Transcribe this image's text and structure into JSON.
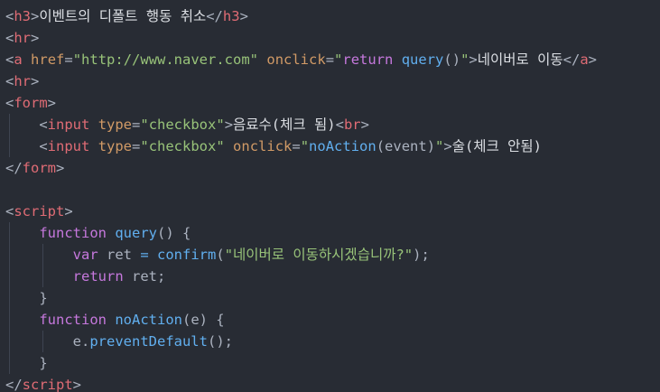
{
  "lines": [
    [
      {
        "t": "<",
        "c": "pun"
      },
      {
        "t": "h3",
        "c": "tag"
      },
      {
        "t": ">",
        "c": "pun"
      },
      {
        "t": "이벤트의 디폴트 행동 취소",
        "c": "txt"
      },
      {
        "t": "</",
        "c": "pun"
      },
      {
        "t": "h3",
        "c": "tag"
      },
      {
        "t": ">",
        "c": "pun"
      }
    ],
    [
      {
        "t": "<",
        "c": "pun"
      },
      {
        "t": "hr",
        "c": "tag"
      },
      {
        "t": ">",
        "c": "pun"
      }
    ],
    [
      {
        "t": "<",
        "c": "pun"
      },
      {
        "t": "a",
        "c": "tag"
      },
      {
        "t": " ",
        "c": "pun"
      },
      {
        "t": "href",
        "c": "attr"
      },
      {
        "t": "=",
        "c": "pun"
      },
      {
        "t": "\"http://www.naver.com\"",
        "c": "str"
      },
      {
        "t": " ",
        "c": "pun"
      },
      {
        "t": "onclick",
        "c": "attr"
      },
      {
        "t": "=",
        "c": "pun"
      },
      {
        "t": "\"",
        "c": "str"
      },
      {
        "t": "return",
        "c": "kw"
      },
      {
        "t": " ",
        "c": "pun"
      },
      {
        "t": "query",
        "c": "fn"
      },
      {
        "t": "()",
        "c": "pun"
      },
      {
        "t": "\"",
        "c": "str"
      },
      {
        "t": ">",
        "c": "pun"
      },
      {
        "t": "네이버로 이동",
        "c": "txt"
      },
      {
        "t": "</",
        "c": "pun"
      },
      {
        "t": "a",
        "c": "tag"
      },
      {
        "t": ">",
        "c": "pun"
      }
    ],
    [
      {
        "t": "<",
        "c": "pun"
      },
      {
        "t": "hr",
        "c": "tag"
      },
      {
        "t": ">",
        "c": "pun"
      }
    ],
    [
      {
        "t": "<",
        "c": "pun"
      },
      {
        "t": "form",
        "c": "tag"
      },
      {
        "t": ">",
        "c": "pun"
      }
    ],
    [
      {
        "t": "    <",
        "c": "pun"
      },
      {
        "t": "input",
        "c": "tag"
      },
      {
        "t": " ",
        "c": "pun"
      },
      {
        "t": "type",
        "c": "attr"
      },
      {
        "t": "=",
        "c": "pun"
      },
      {
        "t": "\"checkbox\"",
        "c": "str"
      },
      {
        "t": ">",
        "c": "pun"
      },
      {
        "t": "음료수(체크 됨)",
        "c": "txt"
      },
      {
        "t": "<",
        "c": "pun"
      },
      {
        "t": "br",
        "c": "tag"
      },
      {
        "t": ">",
        "c": "pun"
      }
    ],
    [
      {
        "t": "    <",
        "c": "pun"
      },
      {
        "t": "input",
        "c": "tag"
      },
      {
        "t": " ",
        "c": "pun"
      },
      {
        "t": "type",
        "c": "attr"
      },
      {
        "t": "=",
        "c": "pun"
      },
      {
        "t": "\"checkbox\"",
        "c": "str"
      },
      {
        "t": " ",
        "c": "pun"
      },
      {
        "t": "onclick",
        "c": "attr"
      },
      {
        "t": "=",
        "c": "pun"
      },
      {
        "t": "\"",
        "c": "str"
      },
      {
        "t": "noAction",
        "c": "fn"
      },
      {
        "t": "(event)",
        "c": "pun"
      },
      {
        "t": "\"",
        "c": "str"
      },
      {
        "t": ">",
        "c": "pun"
      },
      {
        "t": "술(체크 안됨)",
        "c": "txt"
      }
    ],
    [
      {
        "t": "</",
        "c": "pun"
      },
      {
        "t": "form",
        "c": "tag"
      },
      {
        "t": ">",
        "c": "pun"
      }
    ],
    [],
    [
      {
        "t": "<",
        "c": "pun"
      },
      {
        "t": "script",
        "c": "tag"
      },
      {
        "t": ">",
        "c": "pun"
      }
    ],
    [
      {
        "t": "    ",
        "c": "pun"
      },
      {
        "t": "function",
        "c": "kw"
      },
      {
        "t": " ",
        "c": "pun"
      },
      {
        "t": "query",
        "c": "fn"
      },
      {
        "t": "() {",
        "c": "pun"
      }
    ],
    [
      {
        "t": "        ",
        "c": "pun"
      },
      {
        "t": "var",
        "c": "kw"
      },
      {
        "t": " ret ",
        "c": "pun"
      },
      {
        "t": "=",
        "c": "fn"
      },
      {
        "t": " ",
        "c": "pun"
      },
      {
        "t": "confirm",
        "c": "fn"
      },
      {
        "t": "(",
        "c": "pun"
      },
      {
        "t": "\"네이버로 이동하시겠습니까?\"",
        "c": "str"
      },
      {
        "t": ");",
        "c": "pun"
      }
    ],
    [
      {
        "t": "        ",
        "c": "pun"
      },
      {
        "t": "return",
        "c": "kw"
      },
      {
        "t": " ret;",
        "c": "pun"
      }
    ],
    [
      {
        "t": "    }",
        "c": "pun"
      }
    ],
    [
      {
        "t": "    ",
        "c": "pun"
      },
      {
        "t": "function",
        "c": "kw"
      },
      {
        "t": " ",
        "c": "pun"
      },
      {
        "t": "noAction",
        "c": "fn"
      },
      {
        "t": "(e) {",
        "c": "pun"
      }
    ],
    [
      {
        "t": "        e.",
        "c": "pun"
      },
      {
        "t": "preventDefault",
        "c": "fn"
      },
      {
        "t": "();",
        "c": "pun"
      }
    ],
    [
      {
        "t": "    }",
        "c": "pun"
      }
    ],
    [
      {
        "t": "</",
        "c": "pun"
      },
      {
        "t": "script",
        "c": "tag"
      },
      {
        "t": ">",
        "c": "pun"
      }
    ]
  ]
}
